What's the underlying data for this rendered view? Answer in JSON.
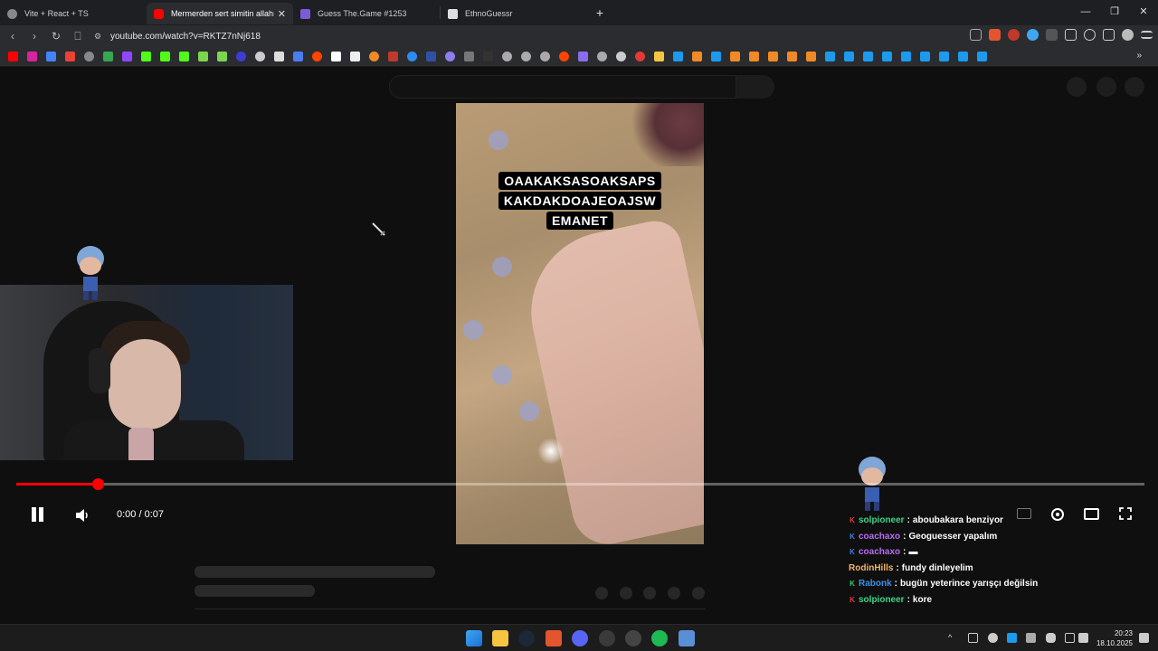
{
  "tabs": [
    {
      "title": "Vite + React + TS",
      "active": false
    },
    {
      "title": "Mermerden sert simitin allahı",
      "active": true
    },
    {
      "title": "Guess The.Game #1253",
      "active": false
    },
    {
      "title": "EthnoGuessr",
      "active": false
    }
  ],
  "newtab_label": "+",
  "window_controls": {
    "minimize": "—",
    "maximize": "❐",
    "close": "✕"
  },
  "url": "youtube.com/watch?v=RKTZ7nNj618",
  "video": {
    "caption_lines": [
      "OAAKAKSASOAKSAPS",
      "KAKDAKDOAJEOAJSW",
      "EMANET"
    ],
    "time": "0:00 / 0:07",
    "progress_fraction": 0.072
  },
  "chat": [
    {
      "badge": "K",
      "badge_color": "#e53935",
      "user": "solpioneer",
      "user_color": "#3fd38a",
      "sep": ":",
      "message": "aboubakara benziyor"
    },
    {
      "badge": "K",
      "badge_color": "#3f7fe0",
      "user": "coachaxo",
      "user_color": "#b86cf0",
      "sep": ":",
      "message": "Geoguesser yapalım"
    },
    {
      "badge": "K",
      "badge_color": "#3f7fe0",
      "user": "coachaxo",
      "user_color": "#b86cf0",
      "sep": ":",
      "message": "▬"
    },
    {
      "badge": "",
      "badge_color": "#000000",
      "user": "RodinHills",
      "user_color": "#f2b36a",
      "sep": ":",
      "message": "fundy dinleyelim"
    },
    {
      "badge": "K",
      "badge_color": "#2ecc71",
      "user": "Rabonk",
      "user_color": "#3f8fe8",
      "sep": ":",
      "message": "bugün yeterince yarışçı değilsin"
    },
    {
      "badge": "K",
      "badge_color": "#e53935",
      "user": "solpioneer",
      "user_color": "#3fd38a",
      "sep": ":",
      "message": "kore"
    }
  ],
  "clock": {
    "time": "20:23",
    "date": "18.10.2025"
  },
  "colors": {
    "accent": "#ff0000",
    "page_bg": "#0f0f0f"
  },
  "icons": [
    "back-icon",
    "forward-icon",
    "reload-icon",
    "bookmark-icon",
    "share-icon",
    "brave-shield-icon",
    "extensions-icon",
    "sidebar-icon",
    "menu-icon",
    "pause-icon",
    "volume-icon",
    "subtitles-icon",
    "settings-icon",
    "theater-icon",
    "fullscreen-icon"
  ]
}
